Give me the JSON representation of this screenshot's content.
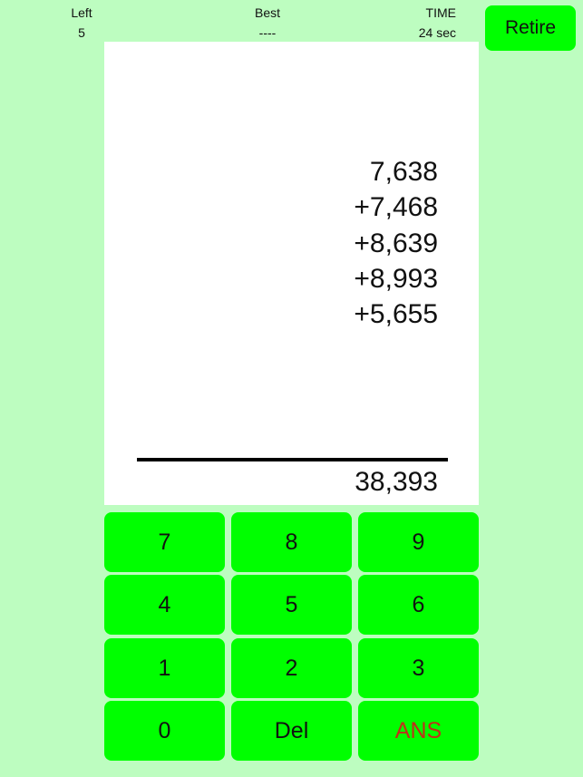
{
  "header": {
    "left": {
      "label": "Left",
      "value": "5"
    },
    "best": {
      "label": "Best",
      "value": "----"
    },
    "time": {
      "label": "TIME",
      "value": "24 sec"
    },
    "retire_label": "Retire"
  },
  "problem": {
    "addends": [
      "7,638",
      "+7,468",
      "+8,639",
      "+8,993",
      "+5,655"
    ],
    "answer": "38,393"
  },
  "keypad": {
    "keys": [
      "7",
      "8",
      "9",
      "4",
      "5",
      "6",
      "1",
      "2",
      "3",
      "0",
      "Del",
      "ANS"
    ]
  },
  "colors": {
    "background": "#bdfdc0",
    "key": "#00ff00",
    "ans_text": "#c0301a",
    "panel": "#ffffff"
  }
}
